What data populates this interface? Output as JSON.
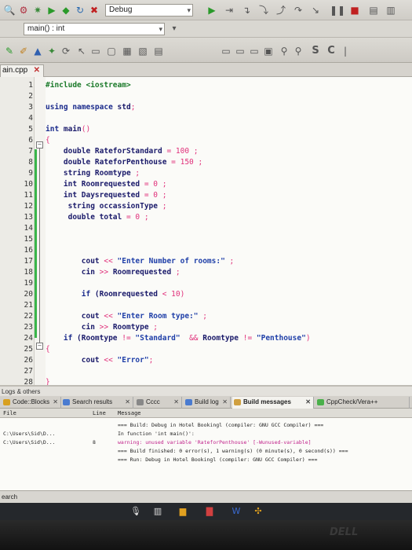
{
  "toolbar": {
    "config_label": "Debug",
    "function_scope": "main() : int",
    "search_symbol": "S",
    "c_symbol": "C"
  },
  "file_tab": {
    "name": "ain.cpp",
    "close": "✕"
  },
  "editor": {
    "line_numbers": [
      "1",
      "2",
      "3",
      "4",
      "5",
      "6",
      "7",
      "8",
      "9",
      "10",
      "11",
      "12",
      "13",
      "14",
      "15",
      "16",
      "17",
      "18",
      "19",
      "20",
      "21",
      "22",
      "23",
      "24",
      "25",
      "26",
      "27",
      "28"
    ],
    "code": {
      "l1": "#include <iostream>",
      "l3a": "using namespace ",
      "l3b": "std",
      "l3c": ";",
      "l5a": "int ",
      "l5b": "main",
      "l5c": "()",
      "l6": "{",
      "l7a": "    double RateforStandard ",
      "l7b": "= 100 ",
      "l7c": ";",
      "l8a": "    double RateforPenthouse ",
      "l8b": "= 150 ",
      "l8c": ";",
      "l9a": "    string Roomtype ",
      "l9b": ";",
      "l10a": "    int Roomrequested ",
      "l10b": "= 0 ",
      "l10c": ";",
      "l11a": "    int Daysrequested ",
      "l11b": "= 0 ",
      "l11c": ";",
      "l12a": "     string occassionType ",
      "l12b": ";",
      "l13a": "     double total ",
      "l13b": "= 0 ",
      "l13c": ";",
      "l17a": "        cout ",
      "l17b": "<< ",
      "l17c": "\"Enter Number of rooms:\"",
      "l17d": " ;",
      "l18a": "        cin ",
      "l18b": ">> ",
      "l18c": "Roomrequested ",
      "l18d": ";",
      "l20a": "        if ",
      "l20b": "(Roomrequested ",
      "l20c": "< 10)",
      "l22a": "        cout ",
      "l22b": "<< ",
      "l22c": "\"Enter Room type:\"",
      "l22d": " ;",
      "l23a": "        cin ",
      "l23b": ">> ",
      "l23c": "Roomtype ",
      "l23d": ";",
      "l24a": "    if ",
      "l24b": "(Roomtype ",
      "l24c": "!= ",
      "l24d": "\"Standard\"",
      "l24e": "  && ",
      "l24f": "Roomtype ",
      "l24g": "!= ",
      "l24h": "\"Penthouse\"",
      "l24i": ")",
      "l25": "{",
      "l26a": "        cout ",
      "l26b": "<< ",
      "l26c": "\"Error\"",
      "l26d": ";",
      "l28": "}"
    }
  },
  "logs": {
    "panel_title": "Logs & others",
    "tabs": [
      {
        "label": "Code::Blocks",
        "color": "#d8a020"
      },
      {
        "label": "Search results",
        "color": "#4a7bd0"
      },
      {
        "label": "Cccc",
        "color": "#888888"
      },
      {
        "label": "Build log",
        "color": "#4a7bd0"
      },
      {
        "label": "Build messages",
        "color": "#d0a040"
      },
      {
        "label": "CppCheck/Vera++",
        "color": "#4ab04a"
      }
    ],
    "columns": {
      "file": "File",
      "line": "Line",
      "message": "Message"
    },
    "rows": [
      {
        "file": "",
        "line": "",
        "message": "=== Build: Debug in Hotel Bookingl (compiler: GNU GCC Compiler) ===",
        "type": "info"
      },
      {
        "file": "C:\\Users\\Sid\\D...",
        "line": "",
        "message": "In function 'int main()':",
        "type": "info"
      },
      {
        "file": "C:\\Users\\Sid\\D...",
        "line": "8",
        "message": "warning: unused variable 'RateforPenthouse' [-Wunused-variable]",
        "type": "warn"
      },
      {
        "file": "",
        "line": "",
        "message": "=== Build finished: 0 error(s), 1 warning(s) (0 minute(s), 0 second(s)) ===",
        "type": "info"
      },
      {
        "file": "",
        "line": "",
        "message": "=== Run: Debug in Hotel Bookingl (compiler: GNU GCC Compiler) ===",
        "type": "info"
      }
    ],
    "search_label": "earch"
  },
  "brand": "DELL"
}
